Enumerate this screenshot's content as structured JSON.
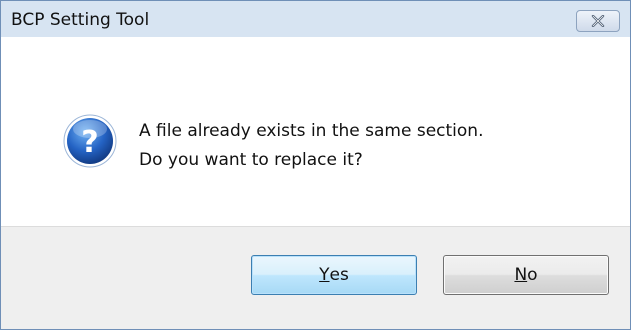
{
  "window": {
    "title": "BCP Setting Tool",
    "close_icon": "close-icon"
  },
  "message": {
    "icon": "question-icon",
    "line1": "A file already exists in the same section.",
    "line2": "Do you want to replace it?"
  },
  "buttons": {
    "yes": {
      "accel": "Y",
      "rest": "es"
    },
    "no": {
      "accel": "N",
      "rest": "o"
    }
  },
  "colors": {
    "title_bar": "#d7e4f2",
    "footer": "#efefef",
    "icon_blue": "#1f5fb8",
    "default_button_border": "#3c7fb1"
  }
}
